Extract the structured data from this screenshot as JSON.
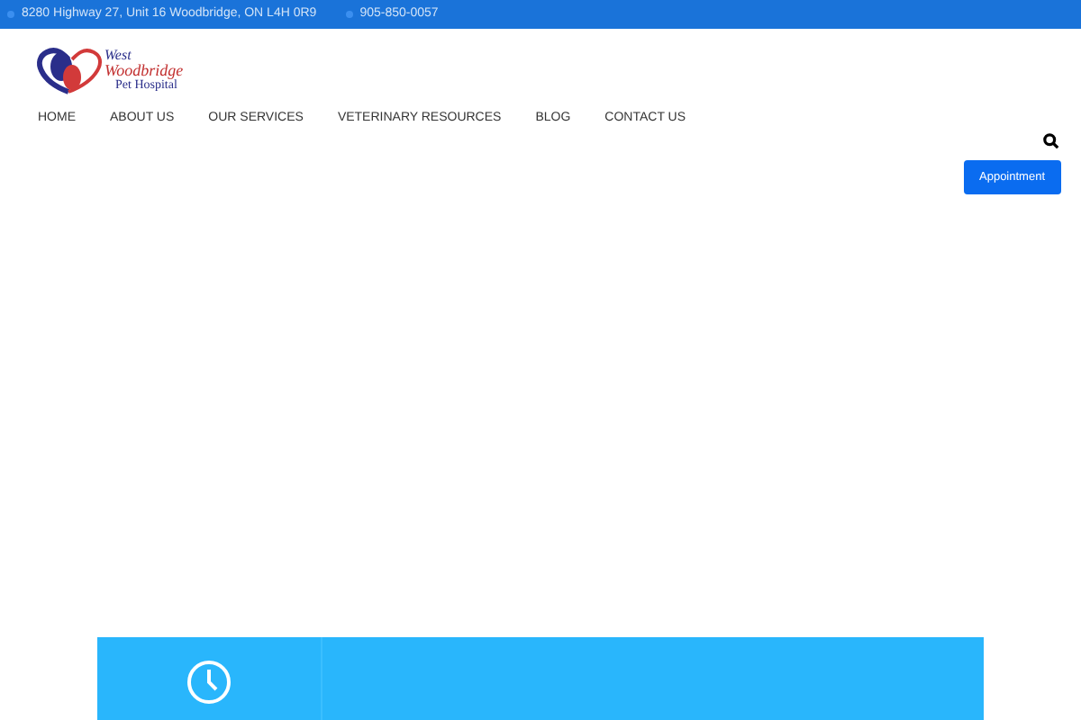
{
  "top_bar": {
    "address": "8280 Highway 27, Unit 16 Woodbridge, ON L4H 0R9",
    "phone": "905-850-0057"
  },
  "logo": {
    "line_1": "West",
    "line_2": "Woodbridge",
    "line_3": "Pet Hospital"
  },
  "nav": [
    {
      "label": "HOME"
    },
    {
      "label": "ABOUT US"
    },
    {
      "label": "OUR SERVICES"
    },
    {
      "label": "VETERINARY RESOURCES"
    },
    {
      "label": "BLOG"
    },
    {
      "label": "CONTACT US"
    }
  ],
  "appointment_button": "Appointment"
}
